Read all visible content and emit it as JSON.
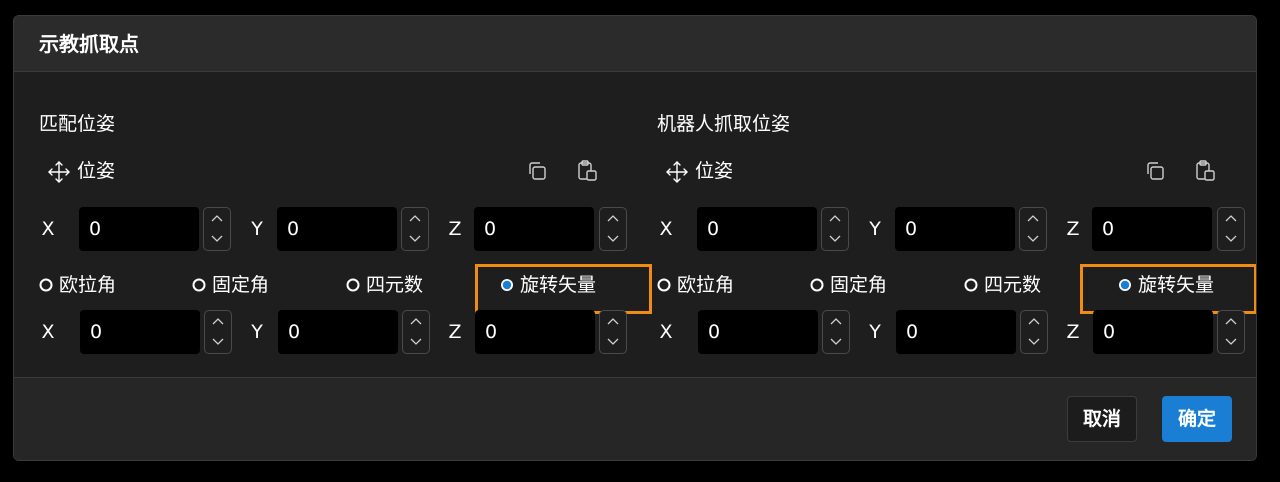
{
  "dialog": {
    "title": "示教抓取点"
  },
  "left_panel": {
    "section_title": "匹配位姿",
    "pose_label": "位姿",
    "position": {
      "x_label": "X",
      "x_value": "0",
      "y_label": "Y",
      "y_value": "0",
      "z_label": "Z",
      "z_value": "0"
    },
    "rotation_modes": [
      {
        "label": "欧拉角",
        "selected": false
      },
      {
        "label": "固定角",
        "selected": false
      },
      {
        "label": "四元数",
        "selected": false
      },
      {
        "label": "旋转矢量",
        "selected": true
      }
    ],
    "rotation": {
      "x_label": "X",
      "x_value": "0",
      "y_label": "Y",
      "y_value": "0",
      "z_label": "Z",
      "z_value": "0"
    }
  },
  "right_panel": {
    "section_title": "机器人抓取位姿",
    "pose_label": "位姿",
    "position": {
      "x_label": "X",
      "x_value": "0",
      "y_label": "Y",
      "y_value": "0",
      "z_label": "Z",
      "z_value": "0"
    },
    "rotation_modes": [
      {
        "label": "欧拉角",
        "selected": false
      },
      {
        "label": "固定角",
        "selected": false
      },
      {
        "label": "四元数",
        "selected": false
      },
      {
        "label": "旋转矢量",
        "selected": true
      }
    ],
    "rotation": {
      "x_label": "X",
      "x_value": "0",
      "y_label": "Y",
      "y_value": "0",
      "z_label": "Z",
      "z_value": "0"
    }
  },
  "footer": {
    "cancel_label": "取消",
    "ok_label": "确定"
  },
  "icons": {
    "pose": "move-arrows-icon",
    "copy": "copy-icon",
    "paste": "clipboard-paste-icon",
    "stepper_up": "chevron-up-icon",
    "stepper_down": "chevron-down-icon"
  },
  "colors": {
    "accent": "#1a7fd4",
    "highlight": "#f08c12",
    "radio_selected": "#1a7fd4"
  }
}
